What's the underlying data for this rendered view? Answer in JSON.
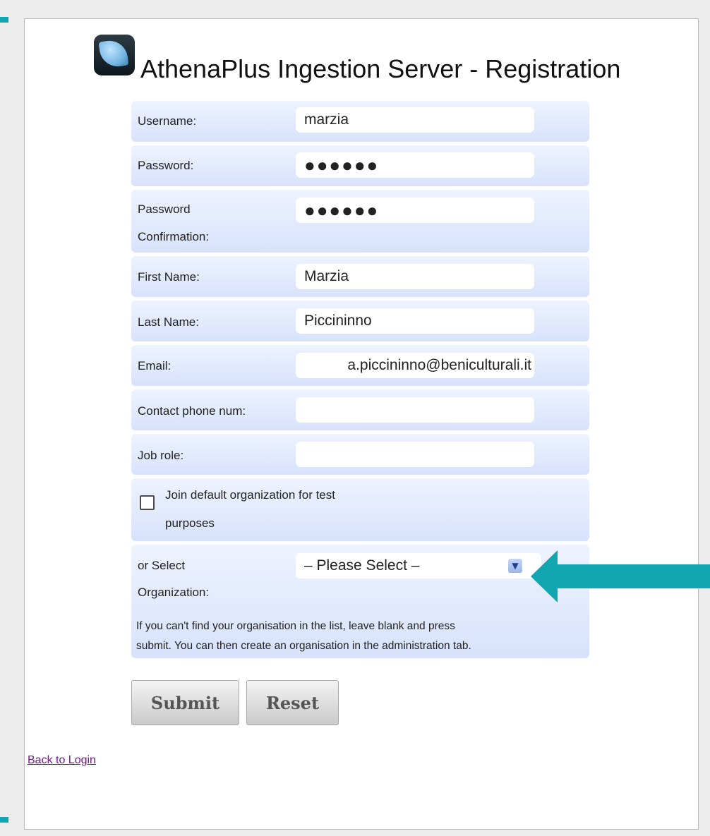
{
  "window": {
    "title": "AthenaPlus Ingestion Server - Registration"
  },
  "form": {
    "username": {
      "label": "Username:",
      "value": "marzia"
    },
    "password": {
      "label": "Password:",
      "value": "●●●●●●"
    },
    "password_confirmation": {
      "label_line1": "Password",
      "label_line2": "Confirmation:",
      "value": "●●●●●●"
    },
    "first_name": {
      "label": "First Name:",
      "value": "Marzia"
    },
    "last_name": {
      "label": "Last Name:",
      "value": "Piccininno"
    },
    "email": {
      "label": "Email:",
      "value": "a.piccininno@beniculturali.it"
    },
    "phone": {
      "label": "Contact phone num:",
      "value": ""
    },
    "job_role": {
      "label": "Job role:",
      "value": ""
    },
    "join_default": {
      "label_line1": "Join default organization for test",
      "label_line2": "purposes",
      "checked": false
    },
    "organization": {
      "label_line1": "or Select",
      "label_line2": "Organization:",
      "selected": "– Please Select –",
      "note_line1": "If you can't find your organisation in the list, leave blank and press",
      "note_line2": "submit. You can then create an organisation in the administration tab."
    }
  },
  "actions": {
    "submit_label": "Submit",
    "reset_label": "Reset"
  },
  "back_link": "Back to Login",
  "annotation": {
    "arrow_color": "#12a6b0",
    "arrow_points_to": "organization-select"
  },
  "icons": {
    "logo": "athenaplus-logo-icon",
    "dropdown": "chevron-down-icon",
    "arrow": "arrow-left-icon"
  }
}
